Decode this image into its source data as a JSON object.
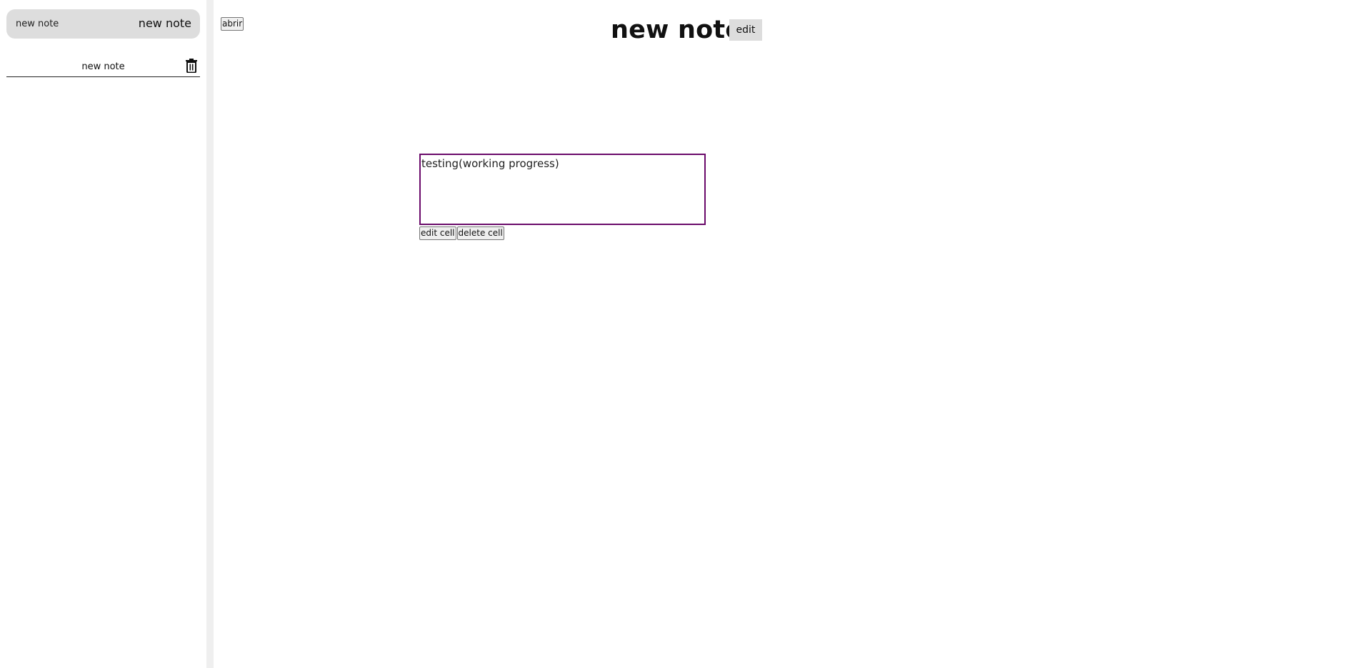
{
  "sidebar": {
    "new_note_input_value": "new note",
    "new_note_button_label": "new note",
    "notes": [
      {
        "label": "new note"
      }
    ]
  },
  "toolbar": {
    "open_button_label": "abrir"
  },
  "note": {
    "title": "new note",
    "edit_label": "edit",
    "cells": [
      {
        "text": "testing(working progress)",
        "edit_label": "edit cell",
        "delete_label": "delete cell"
      }
    ]
  },
  "colors": {
    "cell_border": "#6a0a6a",
    "sidebar_divider": "#efefef",
    "new_note_bar": "#dddddd"
  },
  "icons": {
    "delete_note": "trash-icon"
  }
}
